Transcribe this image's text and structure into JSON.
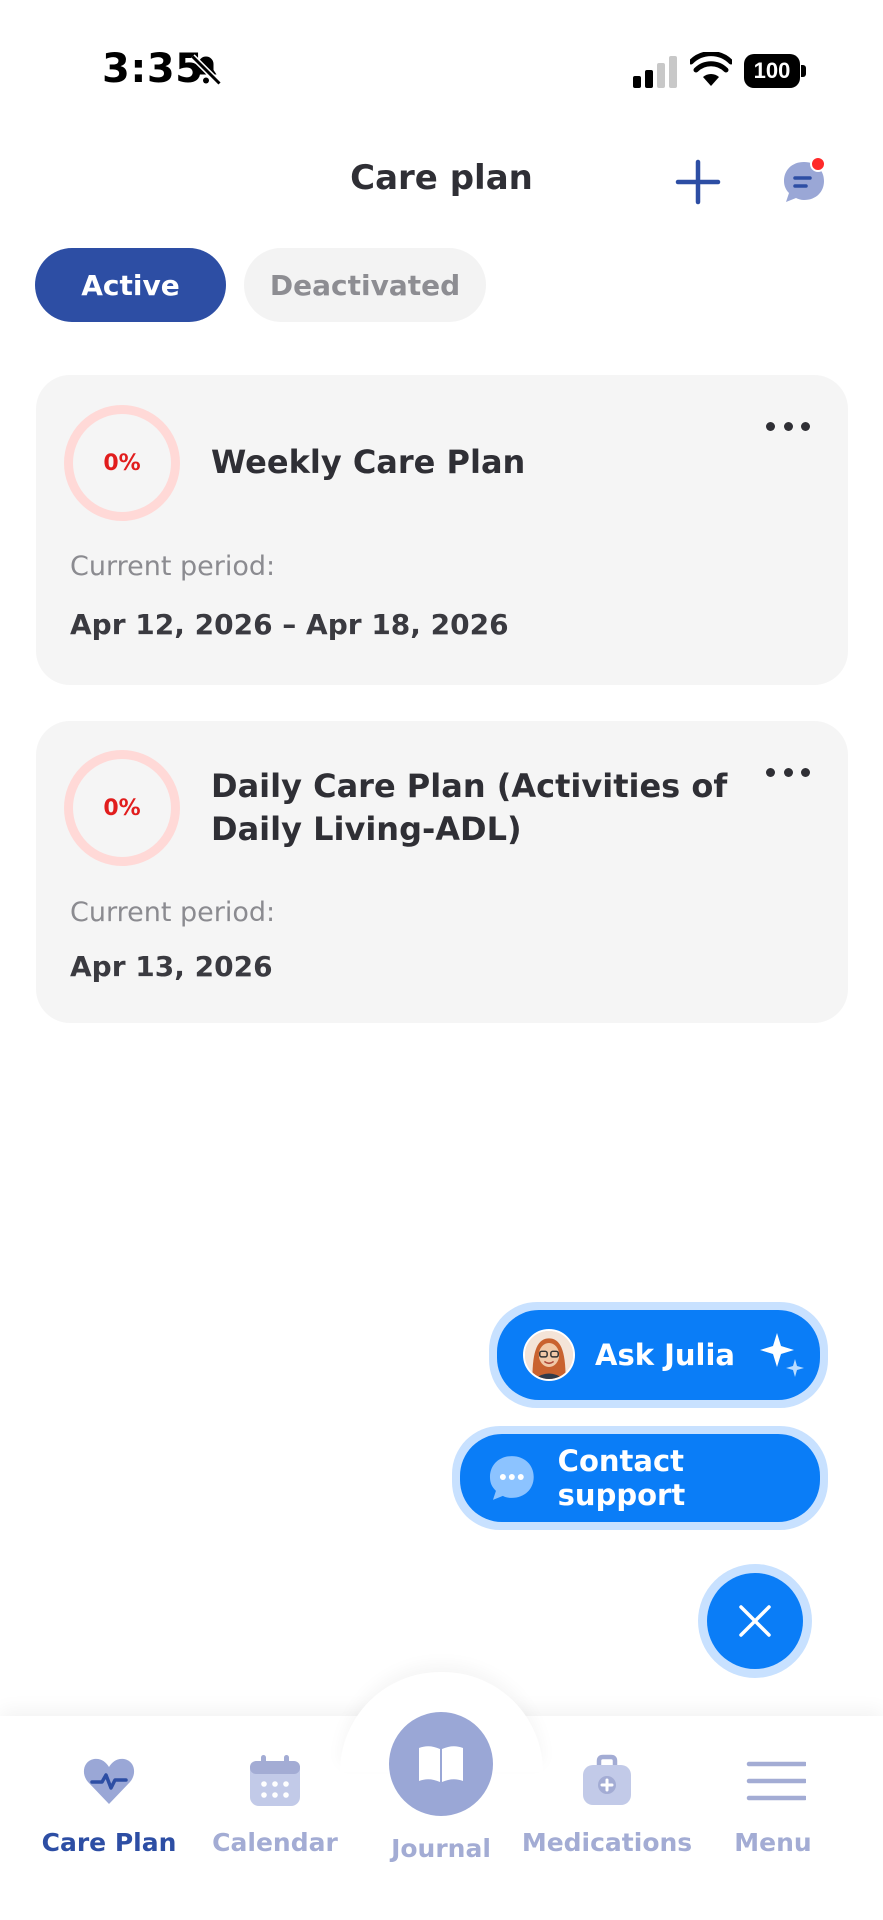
{
  "status_bar": {
    "time": "3:35",
    "battery": "100",
    "icons": [
      "bell-slash-icon",
      "signal-icon",
      "wifi-icon",
      "battery-icon"
    ]
  },
  "header": {
    "title": "Care plan",
    "add_icon": "plus-icon",
    "chat_icon": "chat-icon"
  },
  "tabs": [
    {
      "label": "Active",
      "selected": true
    },
    {
      "label": "Deactivated",
      "selected": false
    }
  ],
  "care_plans": [
    {
      "progress": "0%",
      "title": "Weekly Care Plan",
      "period_label": "Current period:",
      "period": "Apr 12, 2026 – Apr 18, 2026"
    },
    {
      "progress": "0%",
      "title": "Daily Care Plan (Activities of Daily Living-ADL)",
      "period_label": "Current period:",
      "period": "Apr 13, 2026"
    }
  ],
  "fab_menu": {
    "ask_julia": "Ask Julia",
    "contact_support": "Contact support",
    "close_icon": "close-icon"
  },
  "bottom_nav": [
    {
      "label": "Care Plan",
      "icon": "heart-pulse-icon",
      "active": true
    },
    {
      "label": "Calendar",
      "icon": "calendar-icon",
      "active": false
    },
    {
      "label": "Journal",
      "icon": "book-icon",
      "active": false
    },
    {
      "label": "Medications",
      "icon": "medkit-icon",
      "active": false
    },
    {
      "label": "Menu",
      "icon": "menu-icon",
      "active": false
    }
  ],
  "colors": {
    "primary": "#2d4ea4",
    "fab_blue": "#0a7df7",
    "fab_halo": "#c8e1ff",
    "progress_red": "#e11d1d",
    "nav_inactive": "#a3acd4",
    "card_bg": "#f5f5f5"
  }
}
